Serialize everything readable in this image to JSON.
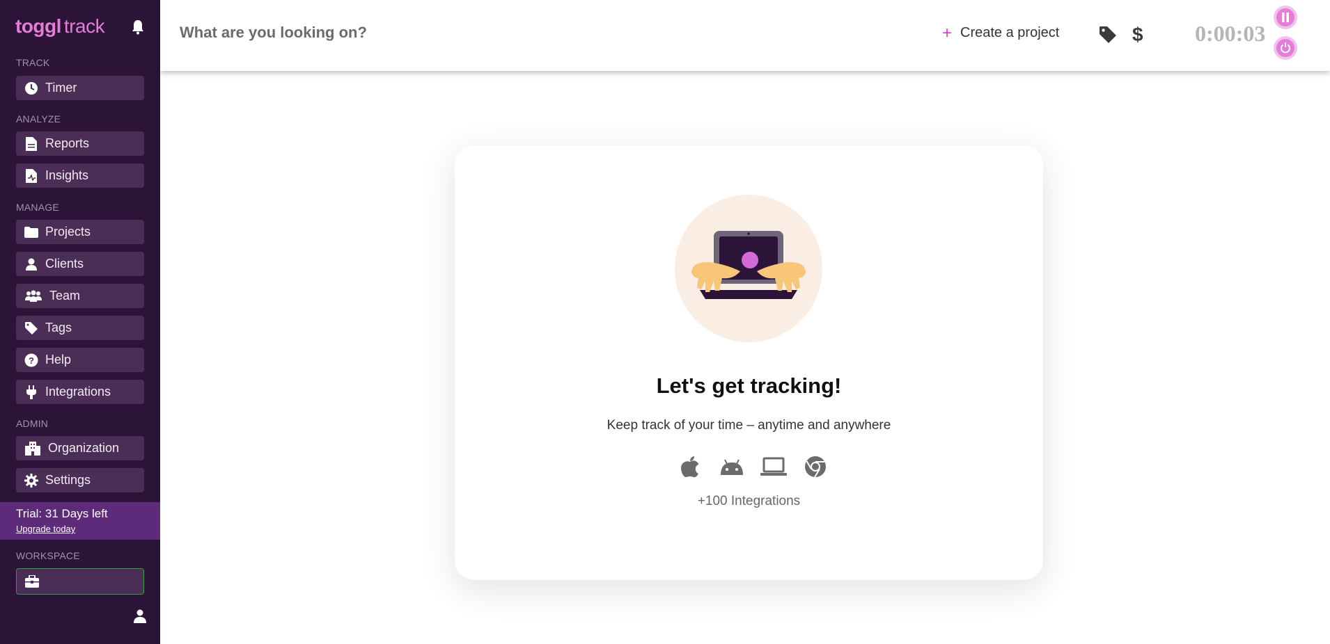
{
  "brand": {
    "bold": "toggl",
    "light": "track"
  },
  "sidebar": {
    "sections": {
      "track": "TRACK",
      "analyze": "ANALYZE",
      "manage": "MANAGE",
      "admin": "ADMIN",
      "workspace": "WORKSPACE"
    },
    "items": {
      "timer": "Timer",
      "reports": "Reports",
      "insights": "Insights",
      "projects": "Projects",
      "clients": "Clients",
      "team": "Team",
      "tags": "Tags",
      "help": "Help",
      "integrations": "Integrations",
      "organization": "Organization",
      "settings": "Settings"
    },
    "trial": {
      "text": "Trial: 31 Days left",
      "link": "Upgrade today"
    }
  },
  "topbar": {
    "description_placeholder": "What are you looking on?",
    "create_project": "Create a project",
    "timer_value": "0:00:03"
  },
  "empty_state": {
    "title": "Let's get tracking!",
    "subtitle": "Keep track of your time – anytime and anywhere",
    "integrations": "+100 Integrations"
  },
  "colors": {
    "sidebar_bg": "#2c1338",
    "nav_item_bg": "#4a2e55",
    "brand_pink": "#e57cd8",
    "trial_bg": "#5e2a7a"
  }
}
